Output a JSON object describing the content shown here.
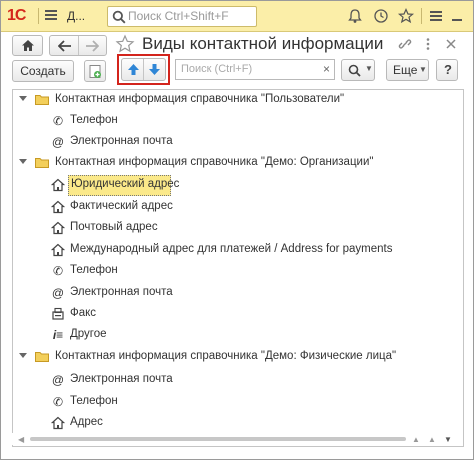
{
  "titlebar": {
    "logo": "1С",
    "app_short": "Д...",
    "search_placeholder": "Поиск Ctrl+Shift+F"
  },
  "header": {
    "title": "Виды контактной информации"
  },
  "toolbar": {
    "create_label": "Создать",
    "search_placeholder": "Поиск (Ctrl+F)",
    "search_clear": "×",
    "more_label": "Еще",
    "move_up_icon": "arrow-up-icon",
    "move_down_icon": "arrow-down-icon"
  },
  "tree": {
    "groups": [
      {
        "label": "Контактная информация справочника \"Пользователи\"",
        "items": [
          {
            "icon": "phone-icon",
            "label": "Телефон"
          },
          {
            "icon": "email-icon",
            "label": "Электронная почта"
          }
        ]
      },
      {
        "label": "Контактная информация справочника \"Демо: Организации\"",
        "items": [
          {
            "icon": "house-icon",
            "label": "Юридический адрес",
            "selected": true
          },
          {
            "icon": "house-icon",
            "label": "Фактический адрес"
          },
          {
            "icon": "house-icon",
            "label": "Почтовый адрес"
          },
          {
            "icon": "house-icon",
            "label": "Международный адрес для платежей / Address for payments"
          },
          {
            "icon": "phone-icon",
            "label": "Телефон"
          },
          {
            "icon": "email-icon",
            "label": "Электронная почта"
          },
          {
            "icon": "fax-icon",
            "label": "Факс"
          },
          {
            "icon": "info-icon",
            "label": "Другое"
          }
        ]
      },
      {
        "label": "Контактная информация справочника \"Демо: Физические лица\"",
        "items": [
          {
            "icon": "email-icon",
            "label": "Электронная почта"
          },
          {
            "icon": "phone-icon",
            "label": "Телефон"
          },
          {
            "icon": "house-icon",
            "label": "Адрес"
          }
        ]
      }
    ]
  },
  "colors": {
    "titlebar": "#fbeea8",
    "selection": "#fbe98a",
    "highlight_frame": "#d3241c",
    "arrow_blue": "#2f86d6"
  }
}
